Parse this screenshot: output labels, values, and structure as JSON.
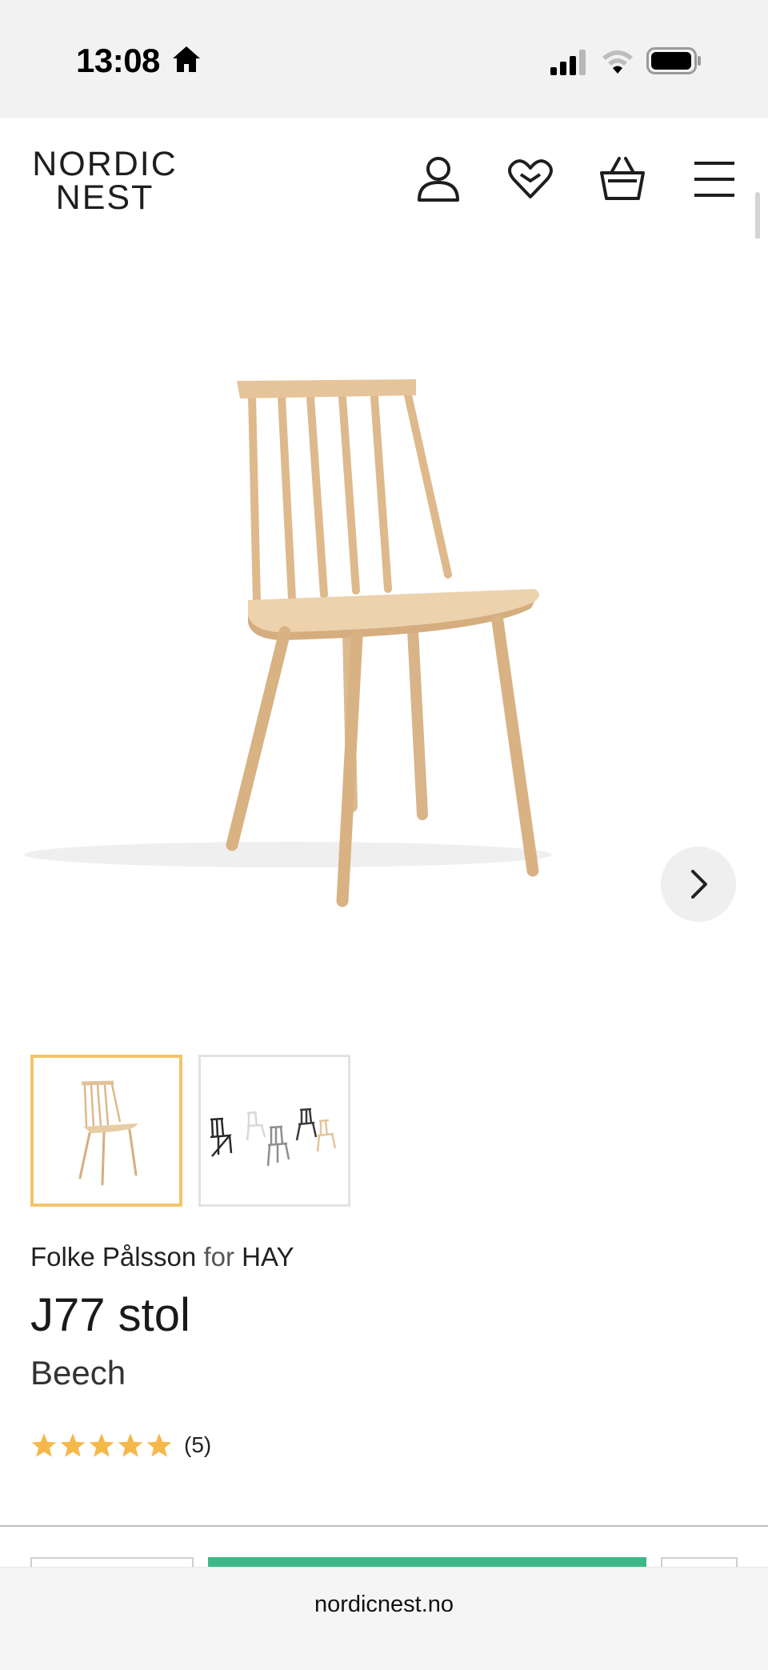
{
  "status": {
    "time": "13:08",
    "home_icon": "home-icon",
    "signal_icon": "signal-icon",
    "wifi_icon": "wifi-icon",
    "battery_icon": "battery-icon"
  },
  "header": {
    "logo_line1": "NORDIC",
    "logo_line2": "NEST",
    "icons": [
      "account-icon",
      "wishlist-heart-icon",
      "basket-icon",
      "menu-icon"
    ]
  },
  "gallery": {
    "next_icon": "chevron-right-icon",
    "thumbnails": [
      "Beech chair",
      "J77 chairs in multiple colors"
    ]
  },
  "product": {
    "designer": "Folke Pålsson",
    "for_word": "for",
    "brand": "HAY",
    "name": "J77 stol",
    "variant": "Beech",
    "rating_count": "(5)",
    "rating_value": 5,
    "rating_max": 5
  },
  "colors": {
    "star": "#f5b84a",
    "active_thumb": "#f2c56b",
    "buy_button": "#3fb887"
  },
  "browser": {
    "url": "nordicnest.no"
  }
}
